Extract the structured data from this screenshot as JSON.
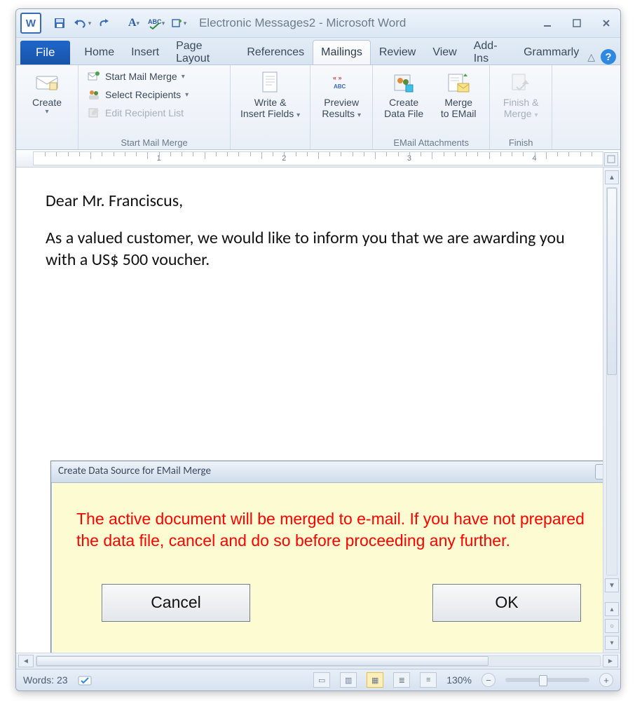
{
  "app": {
    "title": "Electronic Messages2 - Microsoft Word",
    "icon_letter": "W"
  },
  "qat": {
    "save": "save-icon",
    "undo": "undo-icon",
    "redo": "redo-icon"
  },
  "tabs": {
    "file": "File",
    "items": [
      "Home",
      "Insert",
      "Page Layout",
      "References",
      "Mailings",
      "Review",
      "View",
      "Add-Ins",
      "Grammarly"
    ],
    "active_index": 4
  },
  "ribbon": {
    "create": {
      "label_line1": "Create"
    },
    "start_mail_merge": {
      "group_label": "Start Mail Merge",
      "start": "Start Mail Merge",
      "select": "Select Recipients",
      "edit": "Edit Recipient List"
    },
    "write": {
      "label_line1": "Write &",
      "label_line2": "Insert Fields"
    },
    "preview": {
      "label_line1": "Preview",
      "label_line2": "Results"
    },
    "email_attachments": {
      "group_label": "EMail Attachments",
      "create_data": {
        "label_line1": "Create",
        "label_line2": "Data File"
      },
      "merge_email": {
        "label_line1": "Merge",
        "label_line2": "to EMail"
      }
    },
    "finish": {
      "group_label": "Finish",
      "label_line1": "Finish &",
      "label_line2": "Merge"
    }
  },
  "ruler_numbers": [
    "1",
    "2",
    "3",
    "4"
  ],
  "document": {
    "para1": "Dear Mr. Franciscus,",
    "para2": "As a valued customer, we would like to inform you that we are awarding you with a US$ 500 voucher."
  },
  "dialog": {
    "title": "Create Data Source for EMail Merge",
    "message": "The active document will be merged to e-mail. If you have not prepared the data file, cancel and do so before proceeding any further.",
    "cancel": "Cancel",
    "ok": "OK"
  },
  "status": {
    "words_label": "Words:",
    "words_count": "23",
    "zoom_label": "130%"
  }
}
